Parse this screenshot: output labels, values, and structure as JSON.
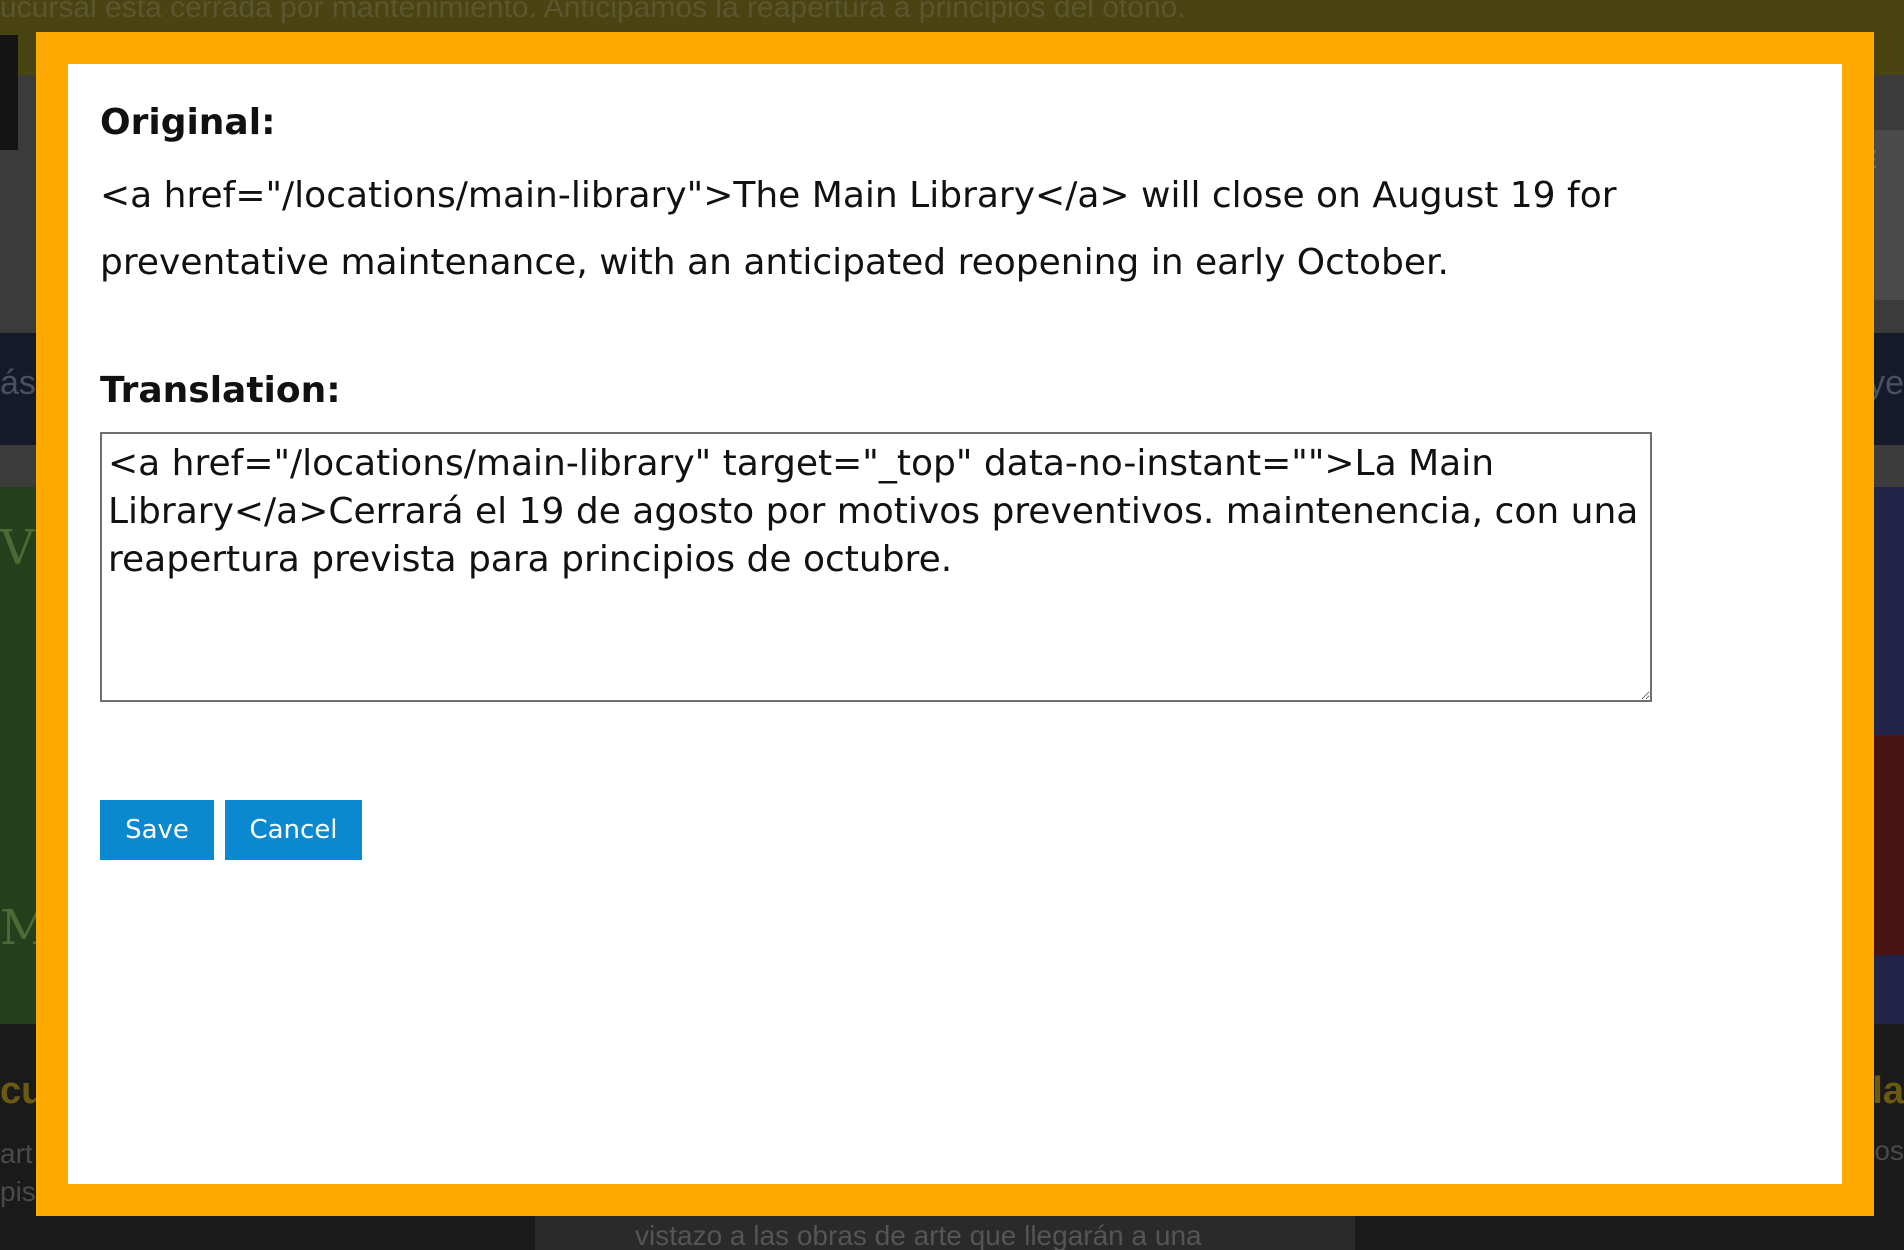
{
  "background": {
    "alert_text": "ucursal está cerrada por mantenimiento. Anticipamos la reapertura a principios del otoño.",
    "nav_left_fragment": "ás",
    "nav_right_fragment": "ye",
    "header_right_fragment": "E",
    "hero_left_top_fragment": "VÍ",
    "hero_left_bottom_fragment": "MÍ",
    "bottom_left_heading": "cu",
    "bottom_left_text_1": "art",
    "bottom_left_text_2": "pis",
    "bottom_right_heading": "la",
    "bottom_right_text": "os",
    "bottom_card_text": "vistazo a las obras de arte que llegarán a una"
  },
  "dialog": {
    "original_label": "Original:",
    "original_text": "<a href=\"/locations/main-library\">The Main Library</a> will close on August 19 for preventative maintenance, with an anticipated reopening in early October.",
    "translation_label": "Translation:",
    "translation_value": "<a href=\"/locations/main-library\" target=\"_top\" data-no-instant=\"\">La Main Library</a>Cerrará el 19 de agosto por motivos preventivos. maintenencia, con una reapertura prevista para principios de octubre.",
    "save_label": "Save",
    "cancel_label": "Cancel"
  },
  "colors": {
    "frame": "#ffaa00",
    "button": "#0a88d0",
    "button_text": "#ffffff"
  }
}
